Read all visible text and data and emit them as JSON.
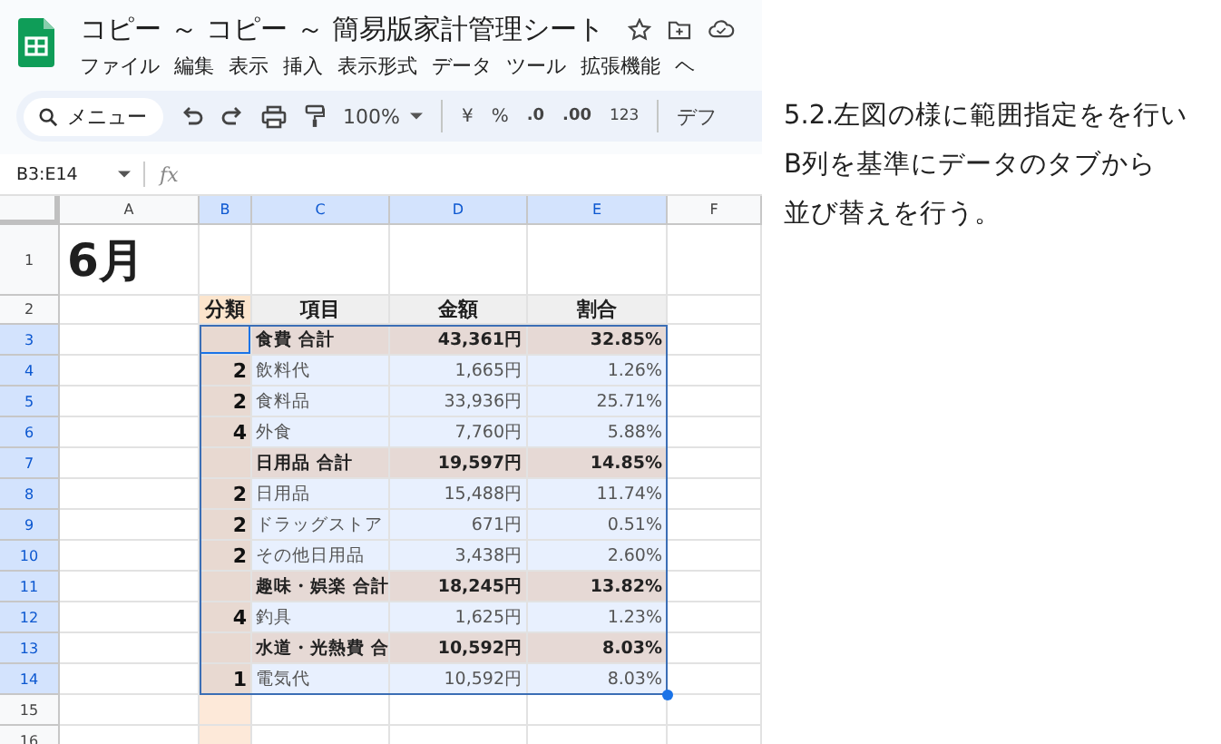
{
  "document": {
    "title": "コピー ～ コピー ～ 簡易版家計管理シート",
    "starred": false
  },
  "menu": [
    "ファイル",
    "編集",
    "表示",
    "挿入",
    "表示形式",
    "データ",
    "ツール",
    "拡張機能",
    "ヘ"
  ],
  "toolbar": {
    "search": "メニュー",
    "zoom": "100%",
    "currency": "¥",
    "percent": "%",
    "decrease_decimal": ".0",
    "increase_decimal": ".00",
    "number_format": "123",
    "font": "デフ"
  },
  "formula_bar": {
    "range": "B3:E14",
    "fx": "fx"
  },
  "sheet": {
    "columns": [
      {
        "label": "A",
        "selected": false
      },
      {
        "label": "B",
        "selected": true
      },
      {
        "label": "C",
        "selected": true
      },
      {
        "label": "D",
        "selected": true
      },
      {
        "label": "E",
        "selected": true
      },
      {
        "label": "F",
        "selected": false
      }
    ],
    "rows": [
      {
        "number": "1",
        "kind": "title",
        "selected": false,
        "title": "6月"
      },
      {
        "number": "2",
        "kind": "header",
        "selected": false,
        "category": "分類",
        "item": "項目",
        "amount": "金額",
        "ratio": "割合"
      },
      {
        "number": "3",
        "kind": "total",
        "selected": true,
        "item": "食費 合計",
        "amount": "43,361円",
        "ratio": "32.85%"
      },
      {
        "number": "4",
        "kind": "item",
        "selected": true,
        "category": "2",
        "item": "飲料代",
        "amount": "1,665円",
        "ratio": "1.26%"
      },
      {
        "number": "5",
        "kind": "item",
        "selected": true,
        "category": "2",
        "item": "食料品",
        "amount": "33,936円",
        "ratio": "25.71%"
      },
      {
        "number": "6",
        "kind": "item",
        "selected": true,
        "category": "4",
        "item": "外食",
        "amount": "7,760円",
        "ratio": "5.88%"
      },
      {
        "number": "7",
        "kind": "total",
        "selected": true,
        "item": "日用品 合計",
        "amount": "19,597円",
        "ratio": "14.85%"
      },
      {
        "number": "8",
        "kind": "item",
        "selected": true,
        "category": "2",
        "item": "日用品",
        "amount": "15,488円",
        "ratio": "11.74%"
      },
      {
        "number": "9",
        "kind": "item",
        "selected": true,
        "category": "2",
        "item": "ドラッグストア",
        "amount": "671円",
        "ratio": "0.51%"
      },
      {
        "number": "10",
        "kind": "item",
        "selected": true,
        "category": "2",
        "item": "その他日用品",
        "amount": "3,438円",
        "ratio": "2.60%"
      },
      {
        "number": "11",
        "kind": "total",
        "selected": true,
        "item": "趣味・娯楽 合計",
        "amount": "18,245円",
        "ratio": "13.82%"
      },
      {
        "number": "12",
        "kind": "item",
        "selected": true,
        "category": "4",
        "item": "釣具",
        "amount": "1,625円",
        "ratio": "1.23%"
      },
      {
        "number": "13",
        "kind": "total",
        "selected": true,
        "item": "水道・光熱費 合",
        "amount": "10,592円",
        "ratio": "8.03%"
      },
      {
        "number": "14",
        "kind": "item",
        "selected": true,
        "category": "1",
        "item": "電気代",
        "amount": "10,592円",
        "ratio": "8.03%"
      },
      {
        "number": "15",
        "kind": "empty",
        "selected": false
      },
      {
        "number": "16",
        "kind": "empty",
        "selected": false
      }
    ]
  },
  "note": [
    "5.2.左図の様に範囲指定をを行い",
    "B列を基準にデータのタブから",
    "並び替えを行う。"
  ]
}
